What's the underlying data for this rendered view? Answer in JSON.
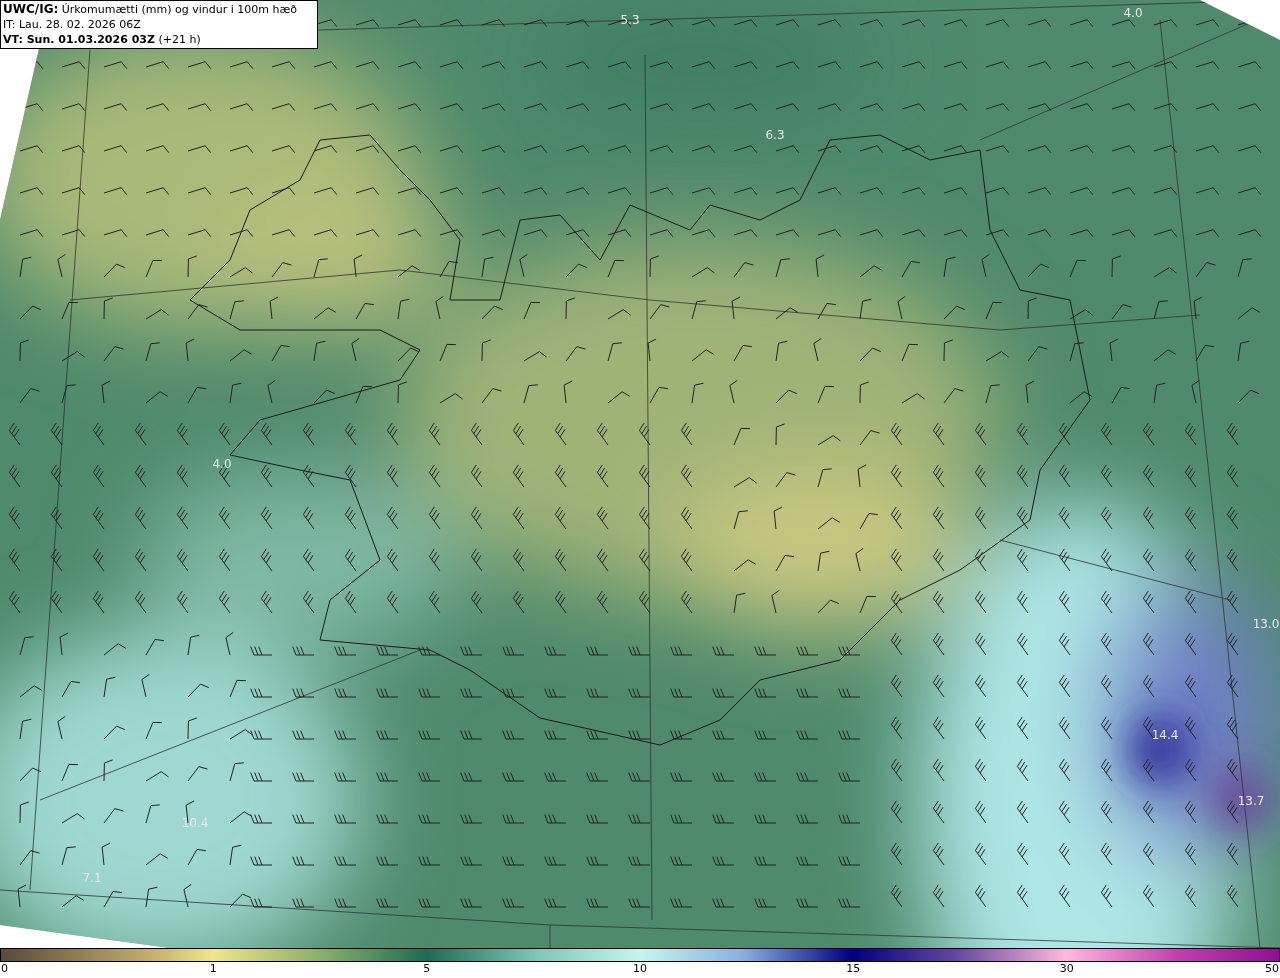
{
  "title_box": {
    "model": "UWC/IG:",
    "description": "Úrkomumætti (mm) og vindur i 100m hæð",
    "issue_time": "IT: Lau. 28. 02. 2026 06Z",
    "valid_time": "VT: Sun. 01.03.2026 03Z",
    "lead": "(+21 h)"
  },
  "map": {
    "value_labels": [
      {
        "text": "5.3"
      },
      {
        "text": "4.0"
      },
      {
        "text": "6.3"
      },
      {
        "text": "4.0"
      },
      {
        "text": "13.0"
      },
      {
        "text": "14.4"
      },
      {
        "text": "13.7"
      },
      {
        "text": "10.4"
      },
      {
        "text": "7.1"
      }
    ]
  },
  "colorbar": {
    "ticks": [
      "0",
      "1",
      "5",
      "10",
      "15",
      "30",
      "50"
    ]
  }
}
